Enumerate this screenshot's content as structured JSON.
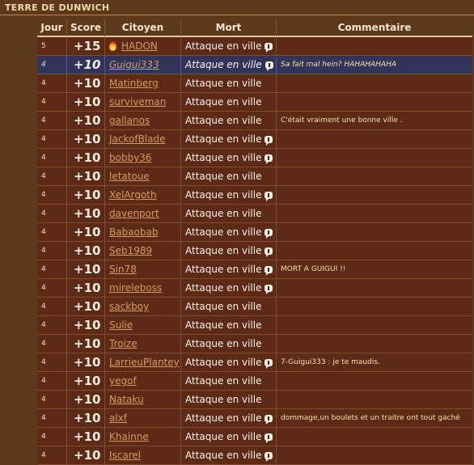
{
  "title": "TERRE DE DUNWICH",
  "headers": {
    "jour": "Jour",
    "score": "Score",
    "citoyen": "Citoyen",
    "mort": "Mort",
    "commentaire": "Commentaire"
  },
  "rows": [
    {
      "jour": "5",
      "score": "+15",
      "citoyen": "HADON",
      "mort": "Attaque en ville",
      "bubble": true,
      "flame": true,
      "comment": ""
    },
    {
      "jour": "4",
      "score": "+10",
      "citoyen": "Guigui333",
      "mort": "Attaque en ville",
      "bubble": true,
      "highlight": true,
      "comment": "Sa fait mal hein? HAHAHAHAHA"
    },
    {
      "jour": "4",
      "score": "+10",
      "citoyen": "Matinberg",
      "mort": "Attaque en ville",
      "bubble": false,
      "comment": ""
    },
    {
      "jour": "4",
      "score": "+10",
      "citoyen": "surviveman",
      "mort": "Attaque en ville",
      "bubble": false,
      "comment": ""
    },
    {
      "jour": "4",
      "score": "+10",
      "citoyen": "gallanos",
      "mort": "Attaque en ville",
      "bubble": false,
      "comment": "C'était vraiment une bonne ville ."
    },
    {
      "jour": "4",
      "score": "+10",
      "citoyen": "JackofBlade",
      "mort": "Attaque en ville",
      "bubble": true,
      "comment": ""
    },
    {
      "jour": "4",
      "score": "+10",
      "citoyen": "bobby36",
      "mort": "Attaque en ville",
      "bubble": true,
      "comment": ""
    },
    {
      "jour": "4",
      "score": "+10",
      "citoyen": "letatoue",
      "mort": "Attaque en ville",
      "bubble": false,
      "comment": ""
    },
    {
      "jour": "4",
      "score": "+10",
      "citoyen": "XelArgoth",
      "mort": "Attaque en ville",
      "bubble": true,
      "comment": ""
    },
    {
      "jour": "4",
      "score": "+10",
      "citoyen": "davenport",
      "mort": "Attaque en ville",
      "bubble": false,
      "comment": ""
    },
    {
      "jour": "4",
      "score": "+10",
      "citoyen": "Babaobab",
      "mort": "Attaque en ville",
      "bubble": true,
      "comment": ""
    },
    {
      "jour": "4",
      "score": "+10",
      "citoyen": "Seb1989",
      "mort": "Attaque en ville",
      "bubble": true,
      "comment": ""
    },
    {
      "jour": "4",
      "score": "+10",
      "citoyen": "Sin78",
      "mort": "Attaque en ville",
      "bubble": true,
      "comment": "MORT A GUIGUI !!"
    },
    {
      "jour": "4",
      "score": "+10",
      "citoyen": "mireleboss",
      "mort": "Attaque en ville",
      "bubble": true,
      "comment": ""
    },
    {
      "jour": "4",
      "score": "+10",
      "citoyen": "sackboy",
      "mort": "Attaque en ville",
      "bubble": false,
      "comment": ""
    },
    {
      "jour": "4",
      "score": "+10",
      "citoyen": "Sulie",
      "mort": "Attaque en ville",
      "bubble": false,
      "comment": ""
    },
    {
      "jour": "4",
      "score": "+10",
      "citoyen": "Troize",
      "mort": "Attaque en ville",
      "bubble": false,
      "comment": ""
    },
    {
      "jour": "4",
      "score": "+10",
      "citoyen": "LarrieuPlantey",
      "mort": "Attaque en ville",
      "bubble": true,
      "comment": "7-Guigui333 : je te maudis."
    },
    {
      "jour": "4",
      "score": "+10",
      "citoyen": "yegof",
      "mort": "Attaque en ville",
      "bubble": false,
      "comment": ""
    },
    {
      "jour": "4",
      "score": "+10",
      "citoyen": "Nataku",
      "mort": "Attaque en ville",
      "bubble": false,
      "comment": ""
    },
    {
      "jour": "4",
      "score": "+10",
      "citoyen": "alxf",
      "mort": "Attaque en ville",
      "bubble": true,
      "comment": "dommage,un boulets et un traitre ont tout gaché"
    },
    {
      "jour": "4",
      "score": "+10",
      "citoyen": "Khainne",
      "mort": "Attaque en ville",
      "bubble": true,
      "comment": ""
    },
    {
      "jour": "4",
      "score": "+10",
      "citoyen": "Iscarel",
      "mort": "Attaque en ville",
      "bubble": true,
      "comment": ""
    }
  ],
  "colors": {
    "background": "#5d391c",
    "row": "#5c2a16",
    "highlight_row": "#33345a",
    "link": "#d39a63",
    "comment": "#f8e2a5"
  }
}
